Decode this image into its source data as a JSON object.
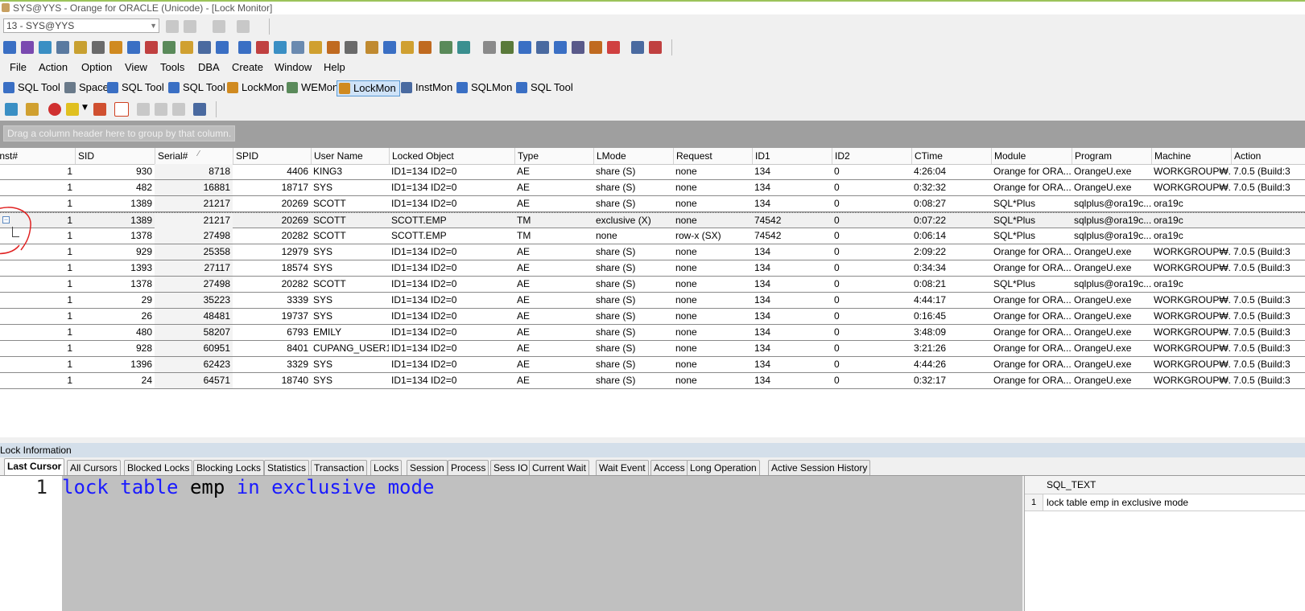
{
  "window": {
    "title": "SYS@YYS - Orange for ORACLE (Unicode) - [Lock Monitor]",
    "connection": "13 - SYS@YYS"
  },
  "menu": [
    {
      "label": "File"
    },
    {
      "label": "Action"
    },
    {
      "label": "Option"
    },
    {
      "label": "View"
    },
    {
      "label": "Tools"
    },
    {
      "label": "DBA"
    },
    {
      "label": "Create"
    },
    {
      "label": "Window"
    },
    {
      "label": "Help"
    }
  ],
  "window_tabs": [
    {
      "label": "SQL Tool",
      "icon": "sql-tool-icon",
      "color": "#3a6fc4"
    },
    {
      "label": "Space",
      "icon": "space-icon",
      "color": "#6a7a8a"
    },
    {
      "label": "SQL Tool",
      "icon": "sql-tool-icon",
      "color": "#3a6fc4"
    },
    {
      "label": "SQL Tool",
      "icon": "sql-tool-icon",
      "color": "#3a6fc4"
    },
    {
      "label": "LockMon",
      "icon": "lock-monitor-icon",
      "color": "#d08a20"
    },
    {
      "label": "WEMon",
      "icon": "wait-event-monitor-icon",
      "color": "#5a8a5a"
    },
    {
      "label": "LockMon",
      "icon": "lock-monitor-icon",
      "color": "#d08a20",
      "active": true
    },
    {
      "label": "InstMon",
      "icon": "instance-monitor-icon",
      "color": "#4a6aa0"
    },
    {
      "label": "SQLMon",
      "icon": "sql-monitor-icon",
      "color": "#3a6fc4"
    },
    {
      "label": "SQL Tool",
      "icon": "sql-tool-icon",
      "color": "#3a6fc4"
    }
  ],
  "group_hint": "Drag a column header here to group by that column.",
  "grid": {
    "columns": [
      "Inst#",
      "SID",
      "Serial#",
      "SPID",
      "User Name",
      "Locked Object",
      "Type",
      "LMode",
      "Request",
      "ID1",
      "ID2",
      "CTime",
      "Module",
      "Program",
      "Machine",
      "Action"
    ],
    "rows": [
      [
        "1",
        "930",
        "8718",
        "4406",
        "KING3",
        "ID1=134 ID2=0",
        "AE",
        "share (S)",
        "none",
        "134",
        "0",
        "4:26:04",
        "Orange for ORA...",
        "OrangeU.exe",
        "WORKGROUP₩...",
        "7.0.5 (Build:3"
      ],
      [
        "1",
        "482",
        "16881",
        "18717",
        "SYS",
        "ID1=134 ID2=0",
        "AE",
        "share (S)",
        "none",
        "134",
        "0",
        "0:32:32",
        "Orange for ORA...",
        "OrangeU.exe",
        "WORKGROUP₩...",
        "7.0.5 (Build:3"
      ],
      [
        "1",
        "1389",
        "21217",
        "20269",
        "SCOTT",
        "ID1=134 ID2=0",
        "AE",
        "share (S)",
        "none",
        "134",
        "0",
        "0:08:27",
        "SQL*Plus",
        "sqlplus@ora19c...",
        "ora19c",
        ""
      ],
      [
        "1",
        "1389",
        "21217",
        "20269",
        "SCOTT",
        "SCOTT.EMP",
        "TM",
        "exclusive (X)",
        "none",
        "74542",
        "0",
        "0:07:22",
        "SQL*Plus",
        "sqlplus@ora19c...",
        "ora19c",
        ""
      ],
      [
        "1",
        "1378",
        "27498",
        "20282",
        "SCOTT",
        "SCOTT.EMP",
        "TM",
        "none",
        "row-x (SX)",
        "74542",
        "0",
        "0:06:14",
        "SQL*Plus",
        "sqlplus@ora19c...",
        "ora19c",
        ""
      ],
      [
        "1",
        "929",
        "25358",
        "12979",
        "SYS",
        "ID1=134 ID2=0",
        "AE",
        "share (S)",
        "none",
        "134",
        "0",
        "2:09:22",
        "Orange for ORA...",
        "OrangeU.exe",
        "WORKGROUP₩...",
        "7.0.5 (Build:3"
      ],
      [
        "1",
        "1393",
        "27117",
        "18574",
        "SYS",
        "ID1=134 ID2=0",
        "AE",
        "share (S)",
        "none",
        "134",
        "0",
        "0:34:34",
        "Orange for ORA...",
        "OrangeU.exe",
        "WORKGROUP₩...",
        "7.0.5 (Build:3"
      ],
      [
        "1",
        "1378",
        "27498",
        "20282",
        "SCOTT",
        "ID1=134 ID2=0",
        "AE",
        "share (S)",
        "none",
        "134",
        "0",
        "0:08:21",
        "SQL*Plus",
        "sqlplus@ora19c...",
        "ora19c",
        ""
      ],
      [
        "1",
        "29",
        "35223",
        "3339",
        "SYS",
        "ID1=134 ID2=0",
        "AE",
        "share (S)",
        "none",
        "134",
        "0",
        "4:44:17",
        "Orange for ORA...",
        "OrangeU.exe",
        "WORKGROUP₩...",
        "7.0.5 (Build:3"
      ],
      [
        "1",
        "26",
        "48481",
        "19737",
        "SYS",
        "ID1=134 ID2=0",
        "AE",
        "share (S)",
        "none",
        "134",
        "0",
        "0:16:45",
        "Orange for ORA...",
        "OrangeU.exe",
        "WORKGROUP₩...",
        "7.0.5 (Build:3"
      ],
      [
        "1",
        "480",
        "58207",
        "6793",
        "EMILY",
        "ID1=134 ID2=0",
        "AE",
        "share (S)",
        "none",
        "134",
        "0",
        "3:48:09",
        "Orange for ORA...",
        "OrangeU.exe",
        "WORKGROUP₩...",
        "7.0.5 (Build:3"
      ],
      [
        "1",
        "928",
        "60951",
        "8401",
        "CUPANG_USER1",
        "ID1=134 ID2=0",
        "AE",
        "share (S)",
        "none",
        "134",
        "0",
        "3:21:26",
        "Orange for ORA...",
        "OrangeU.exe",
        "WORKGROUP₩...",
        "7.0.5 (Build:3"
      ],
      [
        "1",
        "1396",
        "62423",
        "3329",
        "SYS",
        "ID1=134 ID2=0",
        "AE",
        "share (S)",
        "none",
        "134",
        "0",
        "4:44:26",
        "Orange for ORA...",
        "OrangeU.exe",
        "WORKGROUP₩...",
        "7.0.5 (Build:3"
      ],
      [
        "1",
        "24",
        "64571",
        "18740",
        "SYS",
        "ID1=134 ID2=0",
        "AE",
        "share (S)",
        "none",
        "134",
        "0",
        "0:32:17",
        "Orange for ORA...",
        "OrangeU.exe",
        "WORKGROUP₩...",
        "7.0.5 (Build:3"
      ]
    ]
  },
  "lock_info": {
    "title": "Lock Information",
    "tabs": [
      "Last Cursor",
      "All Cursors",
      "Blocked Locks",
      "Blocking Locks",
      "Statistics",
      "Transaction",
      "Locks",
      "Session",
      "Process",
      "Sess IO",
      "Current Wait",
      "Wait Event",
      "Access",
      "Long Operation",
      "Active Session History"
    ],
    "active_tab": "Last Cursor"
  },
  "editor": {
    "line_number": "1",
    "tokens": [
      {
        "text": "lock",
        "kw": true
      },
      {
        "text": " ",
        "kw": false
      },
      {
        "text": "table",
        "kw": true
      },
      {
        "text": " emp ",
        "kw": false
      },
      {
        "text": "in",
        "kw": true
      },
      {
        "text": " ",
        "kw": false
      },
      {
        "text": "exclusive",
        "kw": true
      },
      {
        "text": " ",
        "kw": false
      },
      {
        "text": "mode",
        "kw": true
      }
    ]
  },
  "sql_panel": {
    "header": "SQL_TEXT",
    "row_number": "1",
    "text": "lock table emp in exclusive mode"
  },
  "colors": {
    "keyword": "#1a1aff",
    "active_tab_bg": "#cfe3f8",
    "annotation": "#e02020"
  }
}
